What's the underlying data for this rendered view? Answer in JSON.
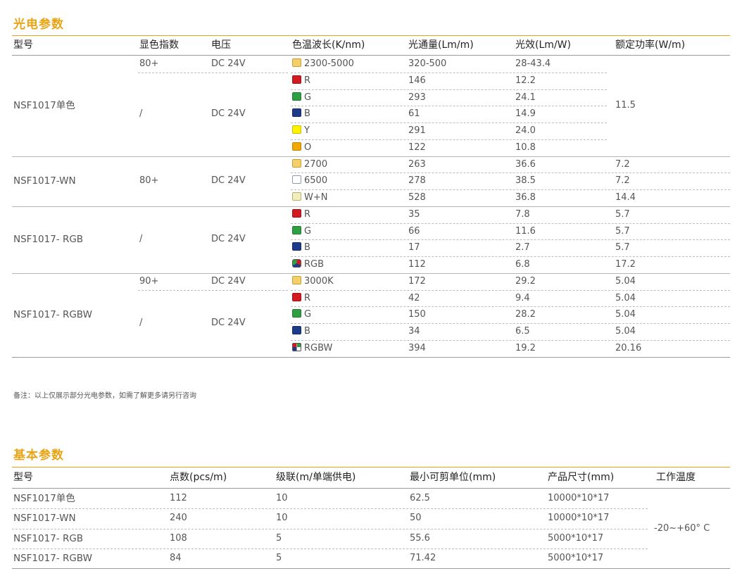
{
  "section1": {
    "title": "光电参数",
    "headers": [
      "型号",
      "显色指数",
      "电压",
      "色温波长(K/nm)",
      "光通量(Lm/m)",
      "光效(Lm/W)",
      "额定功率(W/m)"
    ],
    "groups": [
      {
        "model": "NSF1017单色",
        "cri": "/",
        "voltage": "DC 24V",
        "power": "11.5",
        "rows": [
          {
            "cri": "80+",
            "voltage": "DC 24V",
            "color": "#f4d06a",
            "border": "#c9a030",
            "cct": "2300-5000",
            "flux": "320-500",
            "eff": "28-43.4"
          },
          {
            "color": "#d31a20",
            "border": "#a31015",
            "cct": "R",
            "flux": "146",
            "eff": "12.2"
          },
          {
            "color": "#2ea043",
            "border": "#1f7a30",
            "cct": "G",
            "flux": "293",
            "eff": "24.1"
          },
          {
            "color": "#1e3a8a",
            "border": "#142a66",
            "cct": "B",
            "flux": "61",
            "eff": "14.9"
          },
          {
            "color": "#fff200",
            "border": "#c9bf00",
            "cct": "Y",
            "flux": "291",
            "eff": "24.0"
          },
          {
            "color": "#f0a800",
            "border": "#c08600",
            "cct": "O",
            "flux": "122",
            "eff": "10.8"
          }
        ]
      },
      {
        "model": "NSF1017-WN",
        "cri": "80+",
        "voltage": "DC 24V",
        "rows": [
          {
            "color": "#f4d06a",
            "border": "#c9a030",
            "cct": "2700",
            "flux": "263",
            "eff": "36.6",
            "power": "7.2"
          },
          {
            "color": "#ffffff",
            "border": "#8a9ab0",
            "cct": "6500",
            "flux": "278",
            "eff": "38.5",
            "power": "7.2"
          },
          {
            "color": "#f2eebc",
            "border": "#b4ae70",
            "cct": "W+N",
            "flux": "528",
            "eff": "36.8",
            "power": "14.4"
          }
        ]
      },
      {
        "model": "NSF1017- RGB",
        "cri": "/",
        "voltage": "DC 24V",
        "rows": [
          {
            "color": "#d31a20",
            "border": "#a31015",
            "cct": "R",
            "flux": "35",
            "eff": "7.8",
            "power": "5.7"
          },
          {
            "color": "#2ea043",
            "border": "#1f7a30",
            "cct": "G",
            "flux": "66",
            "eff": "11.6",
            "power": "5.7"
          },
          {
            "color": "#1e3a8a",
            "border": "#142a66",
            "cct": "B",
            "flux": "17",
            "eff": "2.7",
            "power": "5.7"
          },
          {
            "color": "rgb",
            "border": "#555555",
            "cct": "RGB",
            "flux": "112",
            "eff": "6.8",
            "power": "17.2"
          }
        ]
      },
      {
        "model": "NSF1017- RGBW",
        "cri": "/",
        "voltage": "DC 24V",
        "rows": [
          {
            "cri": "90+",
            "voltage": "DC 24V",
            "color": "#f4d06a",
            "border": "#c9a030",
            "cct": "3000K",
            "flux": "172",
            "eff": "29.2",
            "power": "5.04"
          },
          {
            "color": "#d31a20",
            "border": "#a31015",
            "cct": "R",
            "flux": "42",
            "eff": "9.4",
            "power": "5.04"
          },
          {
            "color": "#2ea043",
            "border": "#1f7a30",
            "cct": "G",
            "flux": "150",
            "eff": "28.2",
            "power": "5.04"
          },
          {
            "color": "#1e3a8a",
            "border": "#142a66",
            "cct": "B",
            "flux": "34",
            "eff": "6.5",
            "power": "5.04"
          },
          {
            "color": "rgbw",
            "border": "#555555",
            "cct": "RGBW",
            "flux": "394",
            "eff": "19.2",
            "power": "20.16"
          }
        ]
      }
    ],
    "note": "备注：以上仅展示部分光电参数，如需了解更多请另行咨询"
  },
  "section2": {
    "title": "基本参数",
    "headers": [
      "型号",
      "点数(pcs/m)",
      "级联(m/单端供电)",
      "最小可剪单位(mm)",
      "产品尺寸(mm)",
      "工作温度"
    ],
    "temperature": "-20~+60° C",
    "rows": [
      {
        "model": "NSF1017单色",
        "points": "112",
        "cascade": "10",
        "cut": "62.5",
        "size": "10000*10*17"
      },
      {
        "model": "NSF1017-WN",
        "points": "240",
        "cascade": "10",
        "cut": "50",
        "size": "10000*10*17"
      },
      {
        "model": "NSF1017- RGB",
        "points": "108",
        "cascade": "5",
        "cut": "55.6",
        "size": "5000*10*17"
      },
      {
        "model": "NSF1017- RGBW",
        "points": "84",
        "cascade": "5",
        "cut": "71.42",
        "size": "5000*10*17"
      }
    ]
  },
  "colors": {
    "accent": "#e8a417",
    "rule": "#888888",
    "dash": "#bdbdbd"
  }
}
